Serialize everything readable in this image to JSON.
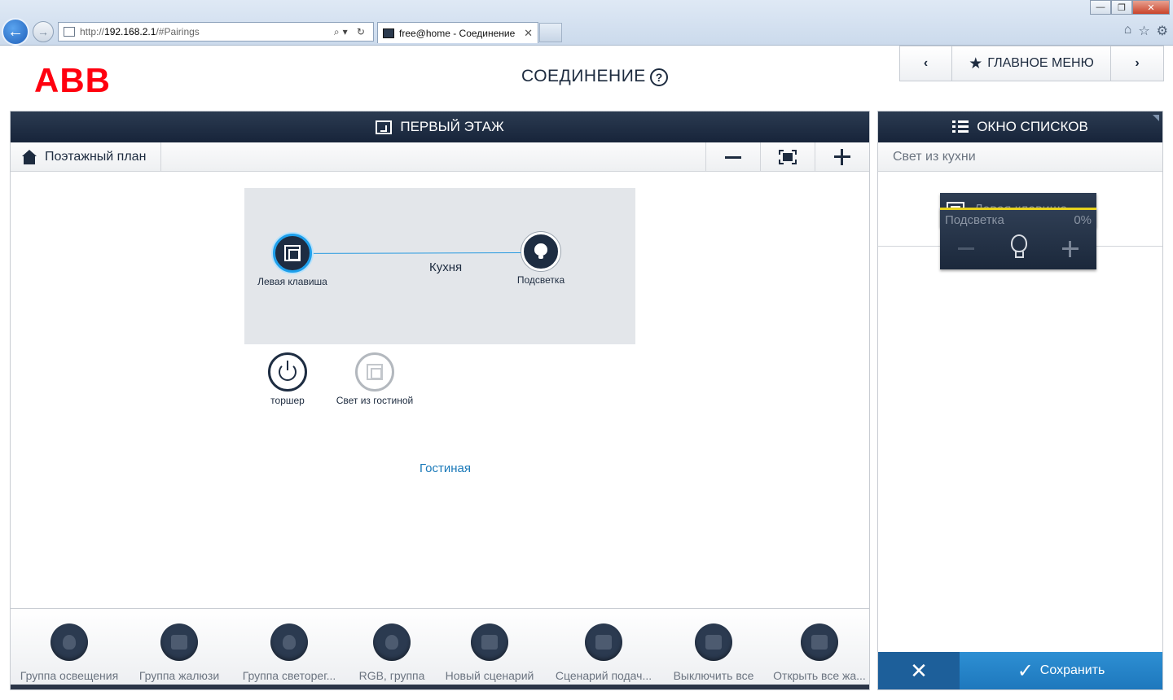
{
  "browser": {
    "url_prefix": "http://",
    "url_host": "192.168.2.1",
    "url_rest": "/#Pairings",
    "tab_title": "free@home - Соединение",
    "addr_tools": "⌕▾ ↻",
    "tab_close": "✕",
    "back_glyph": "←",
    "fwd_glyph": "→",
    "win_min": "—",
    "win_max": "❐",
    "win_close": "✕",
    "tools": [
      "⌂",
      "☆",
      "⚙"
    ]
  },
  "header": {
    "logo": "ABB",
    "title": "СОЕДИНЕНИЕ",
    "help_glyph": "?",
    "nav_prev": "‹",
    "nav_next": "›",
    "main_menu": "ГЛАВНОЕ МЕНЮ",
    "star": "★"
  },
  "left_panel": {
    "title": "ПЕРВЫЙ ЭТАЖ",
    "floorplan_label": "Поэтажный план"
  },
  "rooms": {
    "kitchen": "Кухня",
    "living": "Гостиная"
  },
  "devices": {
    "left_key": "Левая клавиша",
    "backlight": "Подсветка",
    "floor_lamp": "торшер",
    "living_light": "Свет из гостиной"
  },
  "tray": [
    {
      "label": "Группа освещения",
      "icon": "bulb-group-icon"
    },
    {
      "label": "Группа жалюзи",
      "icon": "blinds-group-icon"
    },
    {
      "label": "Группа светорег...",
      "icon": "dimmer-group-icon"
    },
    {
      "label": "RGB, группа",
      "icon": "rgb-group-icon"
    },
    {
      "label": "Новый сценарий",
      "icon": "scene-icon"
    },
    {
      "label": "Сценарий подач...",
      "icon": "panic-scene-icon"
    },
    {
      "label": "Выключить все",
      "icon": "all-off-icon"
    },
    {
      "label": "Открыть все жа...",
      "icon": "open-blinds-icon"
    }
  ],
  "right_panel": {
    "title": "ОКНО СПИСКОВ",
    "subtitle": "Свет из кухни",
    "sensor_tile": "Левая клавиша",
    "actuator_name": "Подсветка",
    "actuator_value": "0%",
    "cancel_glyph": "✕",
    "save_label": "Сохранить",
    "save_glyph": "✓"
  },
  "colors": {
    "accent": "#1ea0ec",
    "header_dark": "#17243a",
    "logo_red": "#ff000f",
    "dimmer_bar": "#e6d21e",
    "save_blue": "#1e78bd"
  }
}
